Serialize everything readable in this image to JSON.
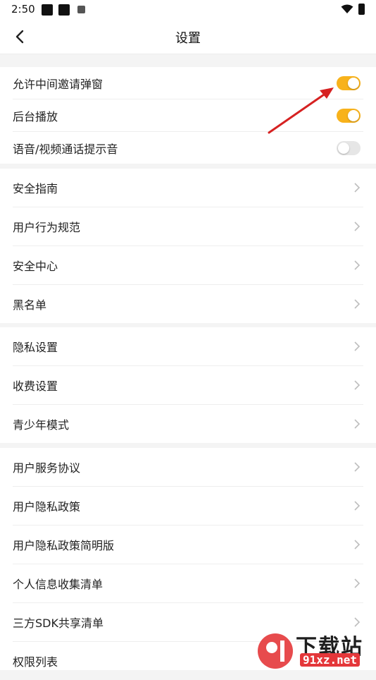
{
  "status_bar": {
    "time": "2:50"
  },
  "header": {
    "title": "设置"
  },
  "toggles": [
    {
      "label": "允许中间邀请弹窗",
      "on": true
    },
    {
      "label": "后台播放",
      "on": true
    },
    {
      "label": "语音/视频通话提示音",
      "on": false
    }
  ],
  "group1": {
    "items": [
      {
        "label": "安全指南"
      },
      {
        "label": "用户行为规范"
      },
      {
        "label": "安全中心"
      },
      {
        "label": "黑名单"
      }
    ]
  },
  "group2": {
    "items": [
      {
        "label": "隐私设置"
      },
      {
        "label": "收费设置"
      },
      {
        "label": "青少年模式"
      }
    ]
  },
  "group3": {
    "items": [
      {
        "label": "用户服务协议"
      },
      {
        "label": "用户隐私政策"
      },
      {
        "label": "用户隐私政策简明版"
      },
      {
        "label": "个人信息收集清单"
      },
      {
        "label": "三方SDK共享清单"
      },
      {
        "label": "权限列表"
      }
    ]
  },
  "watermark": {
    "big": "下载站",
    "small": "91xz.net"
  },
  "colors": {
    "accent": "#f8b21b",
    "toggle_off": "#e6e6e6",
    "annotation_arrow": "#d62121"
  },
  "icons": {
    "back": "chevron-left-icon",
    "row_chevron": "chevron-right-icon"
  }
}
